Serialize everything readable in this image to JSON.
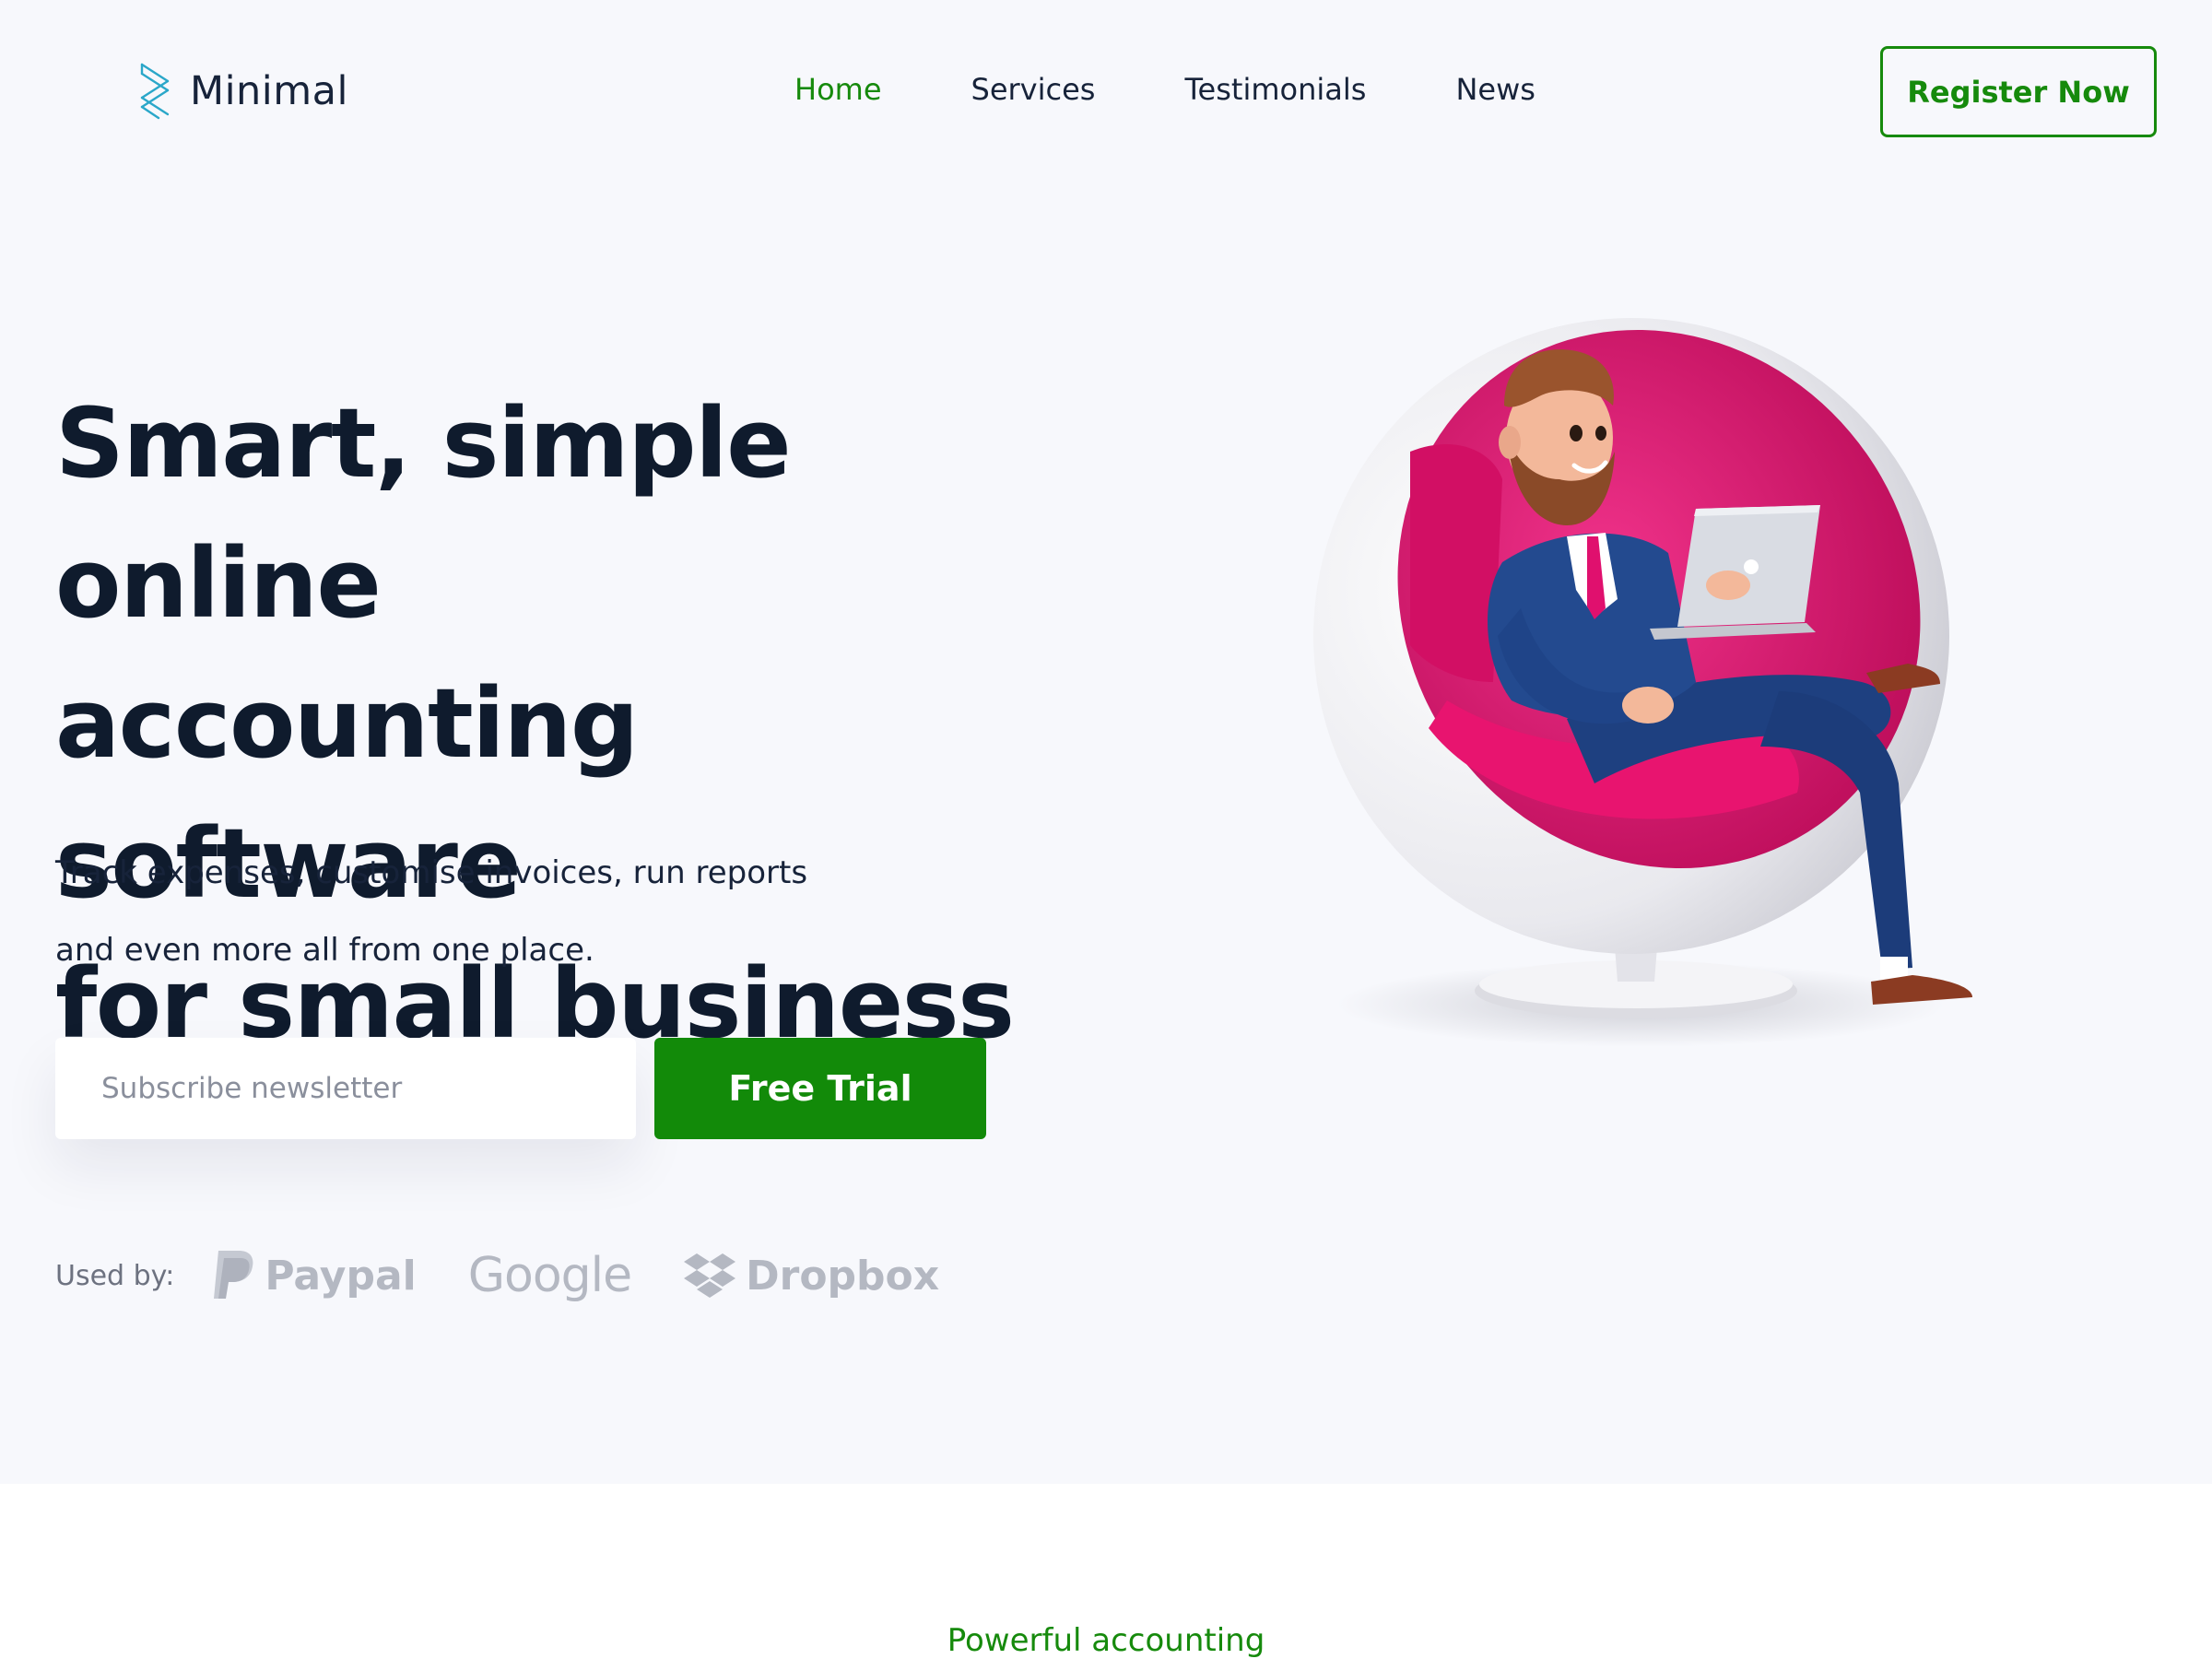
{
  "header": {
    "logo_text": "Minimal",
    "nav": [
      {
        "label": "Home",
        "active": true
      },
      {
        "label": "Services",
        "active": false
      },
      {
        "label": "Testimonials",
        "active": false
      },
      {
        "label": "News",
        "active": false
      }
    ],
    "register_label": "Register Now"
  },
  "hero": {
    "title_lines": [
      "Smart, simple online",
      "accounting software",
      "for small business"
    ],
    "subtitle_lines": [
      "Track expenses, customise invoices, run reports",
      "and even more all from one place."
    ],
    "subscribe_placeholder": "Subscribe newsletter",
    "cta_label": "Free Trial"
  },
  "used_by": {
    "label": "Used by:",
    "brands": [
      {
        "name": "Paypal",
        "icon": "paypal-icon"
      },
      {
        "name": "Google",
        "icon": ""
      },
      {
        "name": "Dropbox",
        "icon": "dropbox-icon"
      }
    ]
  },
  "lower": {
    "eyebrow": "Powerful accounting"
  },
  "colors": {
    "accent": "#168a0c",
    "cta": "#128a09",
    "heading": "#0f1b2d",
    "background": "#f7f8fc",
    "chair": "#e0106e"
  }
}
